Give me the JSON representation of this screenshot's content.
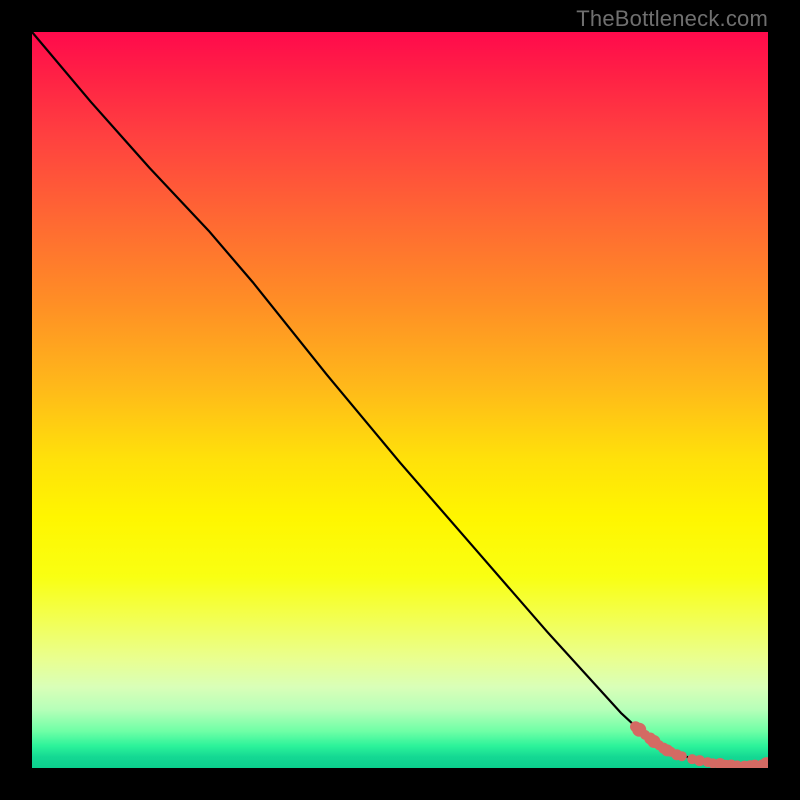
{
  "watermark": "TheBottleneck.com",
  "colors": {
    "marker": "#d46a63",
    "curve": "#000000"
  },
  "chart_data": {
    "type": "line",
    "title": "",
    "xlabel": "",
    "ylabel": "",
    "xlim": [
      0,
      100
    ],
    "ylim": [
      0,
      100
    ],
    "grid": false,
    "curve": {
      "x": [
        0,
        8,
        16,
        24,
        30,
        40,
        50,
        60,
        70,
        80,
        84,
        86,
        88,
        90,
        92,
        94,
        96,
        98,
        100
      ],
      "y": [
        100,
        90.5,
        81.5,
        73,
        66,
        53.5,
        41.5,
        30,
        18.5,
        7.5,
        3.8,
        2.6,
        1.8,
        1.2,
        0.8,
        0.55,
        0.4,
        0.35,
        0.5
      ]
    },
    "markers": {
      "x": [
        82.0,
        82.5,
        83.3,
        84.0,
        84.5,
        85.2,
        85.8,
        86.3,
        86.8,
        87.6,
        88.3,
        89.7,
        90.7,
        91.8,
        92.5,
        93.5,
        94.3,
        95.0,
        95.8,
        96.8,
        97.6,
        98.2,
        99.2,
        99.8
      ],
      "y": [
        5.6,
        5.2,
        4.5,
        4.0,
        3.6,
        3.1,
        2.7,
        2.4,
        2.2,
        1.8,
        1.6,
        1.2,
        1.0,
        0.8,
        0.65,
        0.55,
        0.45,
        0.4,
        0.35,
        0.33,
        0.3,
        0.32,
        0.4,
        0.6
      ],
      "r": [
        5.5,
        7,
        5,
        6,
        6.5,
        5,
        5.5,
        6,
        5,
        5.5,
        5,
        5,
        5.5,
        5,
        5,
        6,
        5,
        5.5,
        5,
        5,
        5.5,
        6,
        5.5,
        6.5
      ]
    }
  }
}
